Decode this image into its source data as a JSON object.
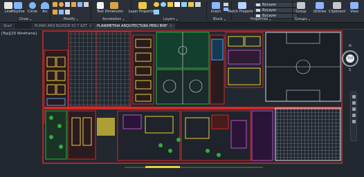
{
  "ribbon": {
    "draw_tools": [
      {
        "label": "Line",
        "color": "#e6e6e6"
      },
      {
        "label": "Polyline",
        "color": "#7fb7ff"
      },
      {
        "label": "Circle",
        "color": "#7fb7ff"
      },
      {
        "label": "Arc",
        "color": "#7fb7ff"
      }
    ],
    "modify_tools": [
      "move",
      "rotate",
      "trim",
      "copy",
      "mirror",
      "fillet",
      "stretch",
      "scale",
      "array"
    ],
    "annotation_tools": [
      {
        "label": "Text",
        "color": "#f2f2f2"
      },
      {
        "label": "Dimension",
        "color": "#d9a24a"
      }
    ],
    "layer_tool": {
      "label": "Layer Properties",
      "color": "#f0c64a"
    },
    "block_tools": [
      {
        "label": "Insert",
        "color": "#8fb6ff"
      }
    ],
    "properties_tool": {
      "label": "Match Properties",
      "color": "#b9d4ff"
    },
    "properties_rows": [
      "ByLayer",
      "ByLayer",
      "ByLayer"
    ],
    "right_tools": [
      {
        "label": "Group",
        "color": "#c5c9cf"
      },
      {
        "label": "Utilities",
        "color": "#8fb6ff"
      },
      {
        "label": "Clipboard",
        "color": "#c5c9cf"
      },
      {
        "label": "View",
        "color": "#8fb6ff"
      }
    ],
    "groups": [
      "Draw",
      "Modify",
      "Annotation",
      "Layers",
      "Block",
      "Properties",
      "Groups"
    ]
  },
  "tabs": [
    {
      "label": "Start",
      "active": false
    },
    {
      "label": "PLANO ARQ BLOQUE 01 Y AZT",
      "active": false
    },
    {
      "label": "PLANIMETRIA ARQUITECTURA PERU BIRF",
      "active": true
    }
  ],
  "viewport_label": "[Top][2D Wireframe]",
  "viewcube": {
    "top_label": "TOP",
    "north": "N",
    "south": "S",
    "west": "W",
    "east": "E"
  },
  "colors": {
    "background": "#212830",
    "wall_red": "#d12a2a",
    "wall_yellow": "#e9d23a",
    "green_field": "#123f2e",
    "tree_green": "#2fae3f",
    "grid_gray": "#9b9ea4"
  }
}
